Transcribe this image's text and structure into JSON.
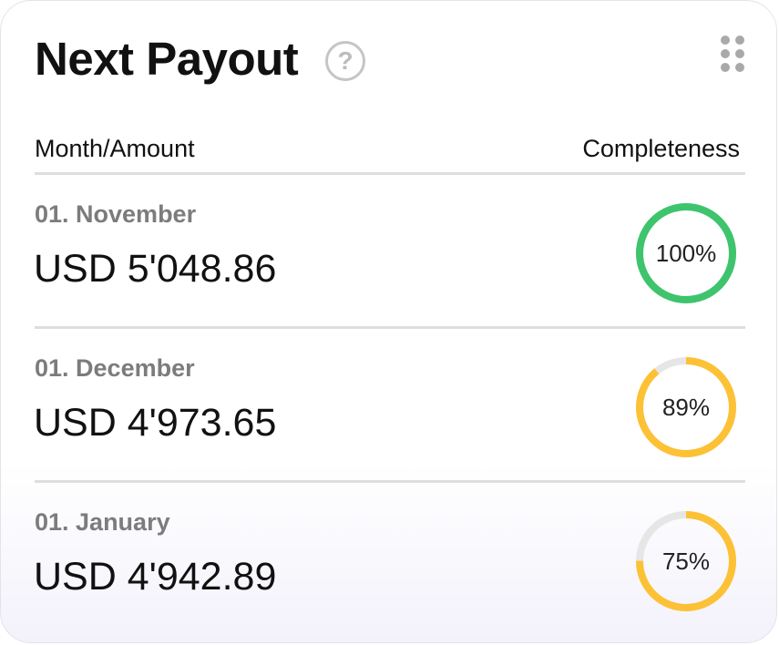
{
  "widget": {
    "title": "Next Payout",
    "help_icon": "question-circle-icon",
    "help_glyph": "?",
    "menu_icon": "drag-handle-icon"
  },
  "table": {
    "headers": {
      "left": "Month/Amount",
      "right": "Completeness"
    },
    "rows": [
      {
        "month": "01. November",
        "amount": "USD 5'048.86",
        "completeness_label": "100%",
        "completeness": 1.0,
        "color": "#3ec46d"
      },
      {
        "month": "01. December",
        "amount": "USD 4'973.65",
        "completeness_label": "89%",
        "completeness": 0.89,
        "color": "#fdc135"
      },
      {
        "month": "01. January",
        "amount": "USD 4'942.89",
        "completeness_label": "75%",
        "completeness": 0.75,
        "color": "#fdc135"
      }
    ]
  },
  "colors": {
    "track": "#e6e6e6",
    "complete": "#3ec46d",
    "partial": "#fdc135"
  }
}
